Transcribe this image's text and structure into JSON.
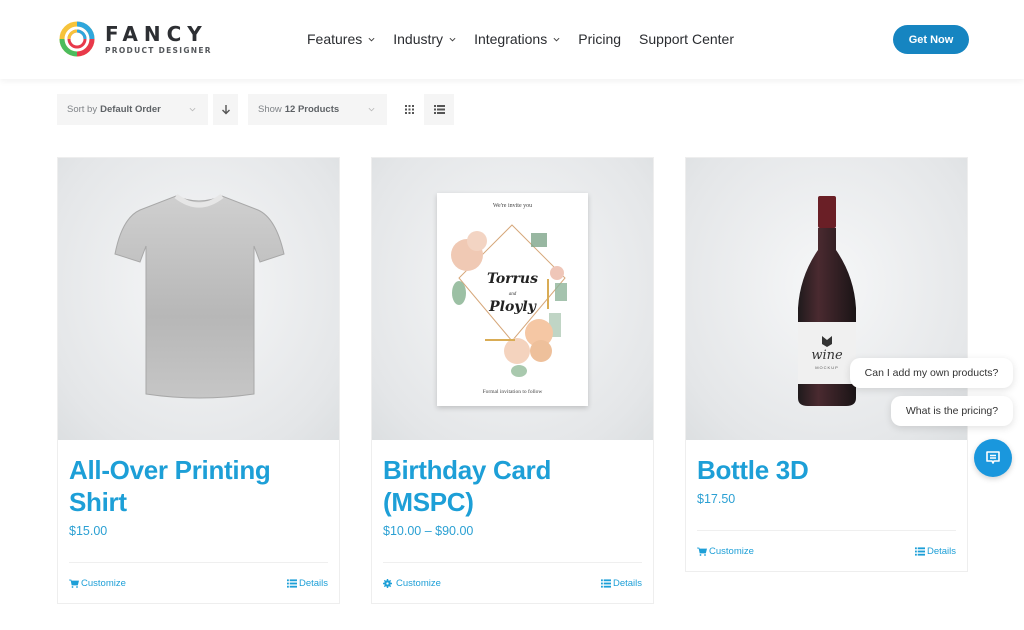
{
  "header": {
    "logo": {
      "title": "FANCY",
      "subtitle": "PRODUCT DESIGNER",
      "icon": "ring-logo-icon"
    },
    "nav": [
      {
        "label": "Features",
        "has_dropdown": true
      },
      {
        "label": "Industry",
        "has_dropdown": true
      },
      {
        "label": "Integrations",
        "has_dropdown": true
      },
      {
        "label": "Pricing",
        "has_dropdown": false
      },
      {
        "label": "Support Center",
        "has_dropdown": false
      }
    ],
    "cta_label": "Get Now"
  },
  "toolbar": {
    "sort_prefix": "Sort by",
    "sort_value": "Default Order",
    "sort_direction_icon": "arrow-down-icon",
    "show_prefix": "Show",
    "show_value": "12 Products",
    "view_grid_icon": "grid-view-icon",
    "view_list_icon": "list-view-icon",
    "active_view": "grid"
  },
  "products": [
    {
      "title": "All-Over Printing Shirt",
      "price": "$15.00",
      "customize_label": "Customize",
      "customize_icon": "cart-icon",
      "details_label": "Details",
      "image": "t-shirt"
    },
    {
      "title": "Birthday Card (MSPC)",
      "price": "$10.00 – $90.00",
      "customize_label": "Customize",
      "customize_icon": "gear-icon",
      "details_label": "Details",
      "image": "invitation-card",
      "card_text": {
        "top": "We're invite you",
        "name1": "Torrus",
        "and": "and",
        "name2": "Ployly",
        "bottom": "Formal invitation to follow"
      }
    },
    {
      "title": "Bottle 3D",
      "price": "$17.50",
      "customize_label": "Customize",
      "customize_icon": "cart-icon",
      "details_label": "Details",
      "image": "wine-bottle",
      "label_text": {
        "brand": "wine",
        "sub": "MOCKUP"
      }
    }
  ],
  "chat": {
    "suggestions": [
      "Can I add my own products?",
      "What is the pricing?"
    ],
    "button_icon": "chat-icon"
  },
  "colors": {
    "accent": "#1d9fd7",
    "cta": "#1685c1",
    "chat": "#1a97dd"
  }
}
